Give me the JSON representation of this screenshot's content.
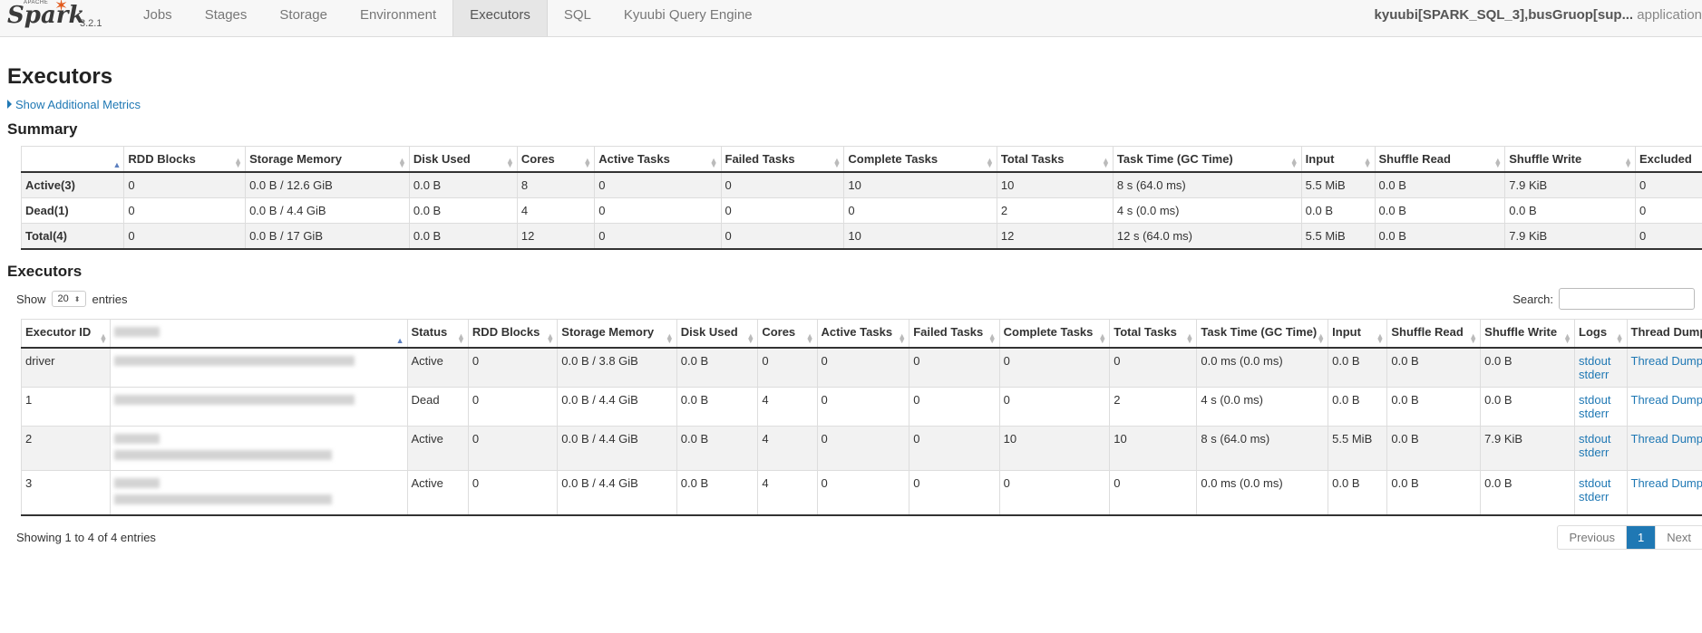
{
  "brand": {
    "apache": "APACHE",
    "name": "Spark",
    "version": "3.2.1"
  },
  "nav": {
    "tabs": [
      "Jobs",
      "Stages",
      "Storage",
      "Environment",
      "Executors",
      "SQL",
      "Kyuubi Query Engine"
    ],
    "active": "Executors",
    "app_name": "kyuubi[SPARK_SQL_3],busGruop[sup...",
    "app_suffix": "application"
  },
  "page": {
    "title": "Executors",
    "additional_metrics": "Show Additional Metrics",
    "summary_heading": "Summary",
    "executors_heading": "Executors"
  },
  "summary": {
    "headers": [
      "",
      "RDD Blocks",
      "Storage Memory",
      "Disk Used",
      "Cores",
      "Active Tasks",
      "Failed Tasks",
      "Complete Tasks",
      "Total Tasks",
      "Task Time (GC Time)",
      "Input",
      "Shuffle Read",
      "Shuffle Write",
      "Excluded"
    ],
    "rows": [
      [
        "Active(3)",
        "0",
        "0.0 B / 12.6 GiB",
        "0.0 B",
        "8",
        "0",
        "0",
        "10",
        "10",
        "8 s (64.0 ms)",
        "5.5 MiB",
        "0.0 B",
        "7.9 KiB",
        "0"
      ],
      [
        "Dead(1)",
        "0",
        "0.0 B / 4.4 GiB",
        "0.0 B",
        "4",
        "0",
        "0",
        "0",
        "2",
        "4 s (0.0 ms)",
        "0.0 B",
        "0.0 B",
        "0.0 B",
        "0"
      ],
      [
        "Total(4)",
        "0",
        "0.0 B / 17 GiB",
        "0.0 B",
        "12",
        "0",
        "0",
        "10",
        "12",
        "12 s (64.0 ms)",
        "5.5 MiB",
        "0.0 B",
        "7.9 KiB",
        "0"
      ]
    ]
  },
  "controls": {
    "show_label": "Show",
    "entries_value": "20",
    "entries_label": "entries",
    "search_label": "Search:"
  },
  "executors": {
    "headers": [
      "Executor ID",
      "",
      "Status",
      "RDD Blocks",
      "Storage Memory",
      "Disk Used",
      "Cores",
      "Active Tasks",
      "Failed Tasks",
      "Complete Tasks",
      "Total Tasks",
      "Task Time (GC Time)",
      "Input",
      "Shuffle Read",
      "Shuffle Write",
      "Logs",
      "Thread Dump"
    ],
    "rows": [
      {
        "id": "driver",
        "status": "Active",
        "rdd": "0",
        "mem": "0.0 B / 3.8 GiB",
        "disk": "0.0 B",
        "cores": "0",
        "active": "0",
        "failed": "0",
        "complete": "0",
        "total": "0",
        "time": "0.0 ms (0.0 ms)",
        "input": "0.0 B",
        "sread": "0.0 B",
        "swrite": "0.0 B",
        "stdout": "stdout",
        "stderr": "stderr",
        "dump": "Thread Dump"
      },
      {
        "id": "1",
        "status": "Dead",
        "rdd": "0",
        "mem": "0.0 B / 4.4 GiB",
        "disk": "0.0 B",
        "cores": "4",
        "active": "0",
        "failed": "0",
        "complete": "0",
        "total": "2",
        "time": "4 s (0.0 ms)",
        "input": "0.0 B",
        "sread": "0.0 B",
        "swrite": "0.0 B",
        "stdout": "stdout",
        "stderr": "stderr",
        "dump": "Thread Dump"
      },
      {
        "id": "2",
        "status": "Active",
        "rdd": "0",
        "mem": "0.0 B / 4.4 GiB",
        "disk": "0.0 B",
        "cores": "4",
        "active": "0",
        "failed": "0",
        "complete": "10",
        "total": "10",
        "time": "8 s (64.0 ms)",
        "input": "5.5 MiB",
        "sread": "0.0 B",
        "swrite": "7.9 KiB",
        "stdout": "stdout",
        "stderr": "stderr",
        "dump": "Thread Dump"
      },
      {
        "id": "3",
        "status": "Active",
        "rdd": "0",
        "mem": "0.0 B / 4.4 GiB",
        "disk": "0.0 B",
        "cores": "4",
        "active": "0",
        "failed": "0",
        "complete": "0",
        "total": "0",
        "time": "0.0 ms (0.0 ms)",
        "input": "0.0 B",
        "sread": "0.0 B",
        "swrite": "0.0 B",
        "stdout": "stdout",
        "stderr": "stderr",
        "dump": "Thread Dump"
      }
    ]
  },
  "footer": {
    "showing": "Showing 1 to 4 of 4 entries",
    "previous": "Previous",
    "page": "1",
    "next": "Next"
  }
}
